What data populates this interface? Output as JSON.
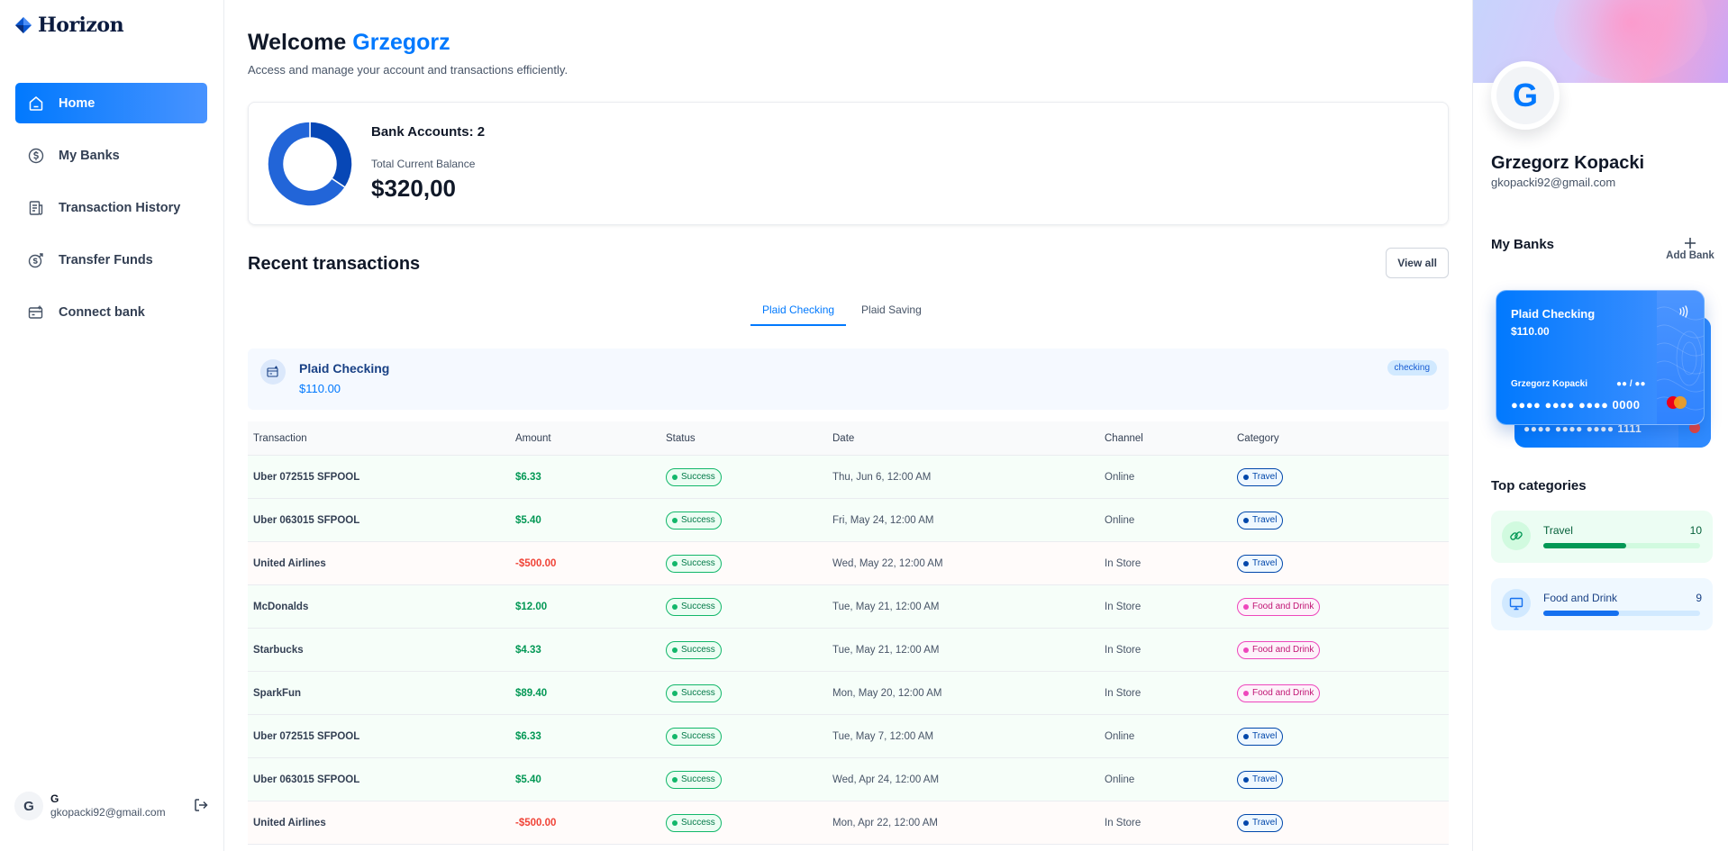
{
  "app": {
    "name": "Horizon"
  },
  "sidebar": {
    "items": [
      {
        "label": "Home",
        "icon": "home-icon",
        "active": true
      },
      {
        "label": "My Banks",
        "icon": "dollar-circle-icon",
        "active": false
      },
      {
        "label": "Transaction History",
        "icon": "receipt-icon",
        "active": false
      },
      {
        "label": "Transfer Funds",
        "icon": "money-send-icon",
        "active": false
      },
      {
        "label": "Connect bank",
        "icon": "connect-bank-icon",
        "active": false
      }
    ],
    "footer": {
      "initial": "G",
      "name": "G",
      "email": "gkopacki92@gmail.com"
    }
  },
  "header": {
    "welcome": "Welcome",
    "user_first_name": "Grzegorz",
    "subtitle": "Access and manage your account and transactions efficiently."
  },
  "balance": {
    "accounts_label": "Bank Accounts: 2",
    "total_label": "Total Current Balance",
    "total_value": "$320,00",
    "donut": [
      {
        "name": "Plaid Checking",
        "value": 110,
        "color": "#0747b6"
      },
      {
        "name": "Plaid Saving",
        "value": 210,
        "color": "#2265d8"
      }
    ]
  },
  "recent": {
    "title": "Recent transactions",
    "view_all": "View all",
    "tabs": [
      "Plaid Checking",
      "Plaid Saving"
    ],
    "active_tab": 0,
    "account": {
      "name": "Plaid Checking",
      "balance": "$110.00",
      "type": "checking"
    },
    "columns": [
      "Transaction",
      "Amount",
      "Status",
      "Date",
      "Channel",
      "Category"
    ],
    "rows": [
      {
        "name": "Uber 072515 SFPOOL",
        "amount": "$6.33",
        "negative": false,
        "status": "Success",
        "date": "Thu, Jun 6, 12:00 AM",
        "channel": "Online",
        "category": "Travel"
      },
      {
        "name": "Uber 063015 SFPOOL",
        "amount": "$5.40",
        "negative": false,
        "status": "Success",
        "date": "Fri, May 24, 12:00 AM",
        "channel": "Online",
        "category": "Travel"
      },
      {
        "name": "United Airlines",
        "amount": "-$500.00",
        "negative": true,
        "status": "Success",
        "date": "Wed, May 22, 12:00 AM",
        "channel": "In Store",
        "category": "Travel"
      },
      {
        "name": "McDonalds",
        "amount": "$12.00",
        "negative": false,
        "status": "Success",
        "date": "Tue, May 21, 12:00 AM",
        "channel": "In Store",
        "category": "Food and Drink"
      },
      {
        "name": "Starbucks",
        "amount": "$4.33",
        "negative": false,
        "status": "Success",
        "date": "Tue, May 21, 12:00 AM",
        "channel": "In Store",
        "category": "Food and Drink"
      },
      {
        "name": "SparkFun",
        "amount": "$89.40",
        "negative": false,
        "status": "Success",
        "date": "Mon, May 20, 12:00 AM",
        "channel": "In Store",
        "category": "Food and Drink"
      },
      {
        "name": "Uber 072515 SFPOOL",
        "amount": "$6.33",
        "negative": false,
        "status": "Success",
        "date": "Tue, May 7, 12:00 AM",
        "channel": "Online",
        "category": "Travel"
      },
      {
        "name": "Uber 063015 SFPOOL",
        "amount": "$5.40",
        "negative": false,
        "status": "Success",
        "date": "Wed, Apr 24, 12:00 AM",
        "channel": "Online",
        "category": "Travel"
      },
      {
        "name": "United Airlines",
        "amount": "-$500.00",
        "negative": true,
        "status": "Success",
        "date": "Mon, Apr 22, 12:00 AM",
        "channel": "In Store",
        "category": "Travel"
      }
    ]
  },
  "profile": {
    "initial": "G",
    "name": "Grzegorz Kopacki",
    "email": "gkopacki92@gmail.com"
  },
  "my_banks": {
    "title": "My Banks",
    "add_label": "Add Bank",
    "add_icon": "plus-icon",
    "card": {
      "title": "Plaid Checking",
      "balance": "$110.00",
      "holder": "Grzegorz Kopacki",
      "expiry": "●● / ●●",
      "number": "●●●● ●●●● ●●●● 0000"
    },
    "card_back_number": "●●●● ●●●● ●●●● 1111"
  },
  "top_categories": {
    "title": "Top categories",
    "items": [
      {
        "name": "Travel",
        "count": "10",
        "fill": 0.53,
        "icon": "link-icon"
      },
      {
        "name": "Food and Drink",
        "count": "9",
        "fill": 0.48,
        "icon": "monitor-icon"
      }
    ]
  }
}
